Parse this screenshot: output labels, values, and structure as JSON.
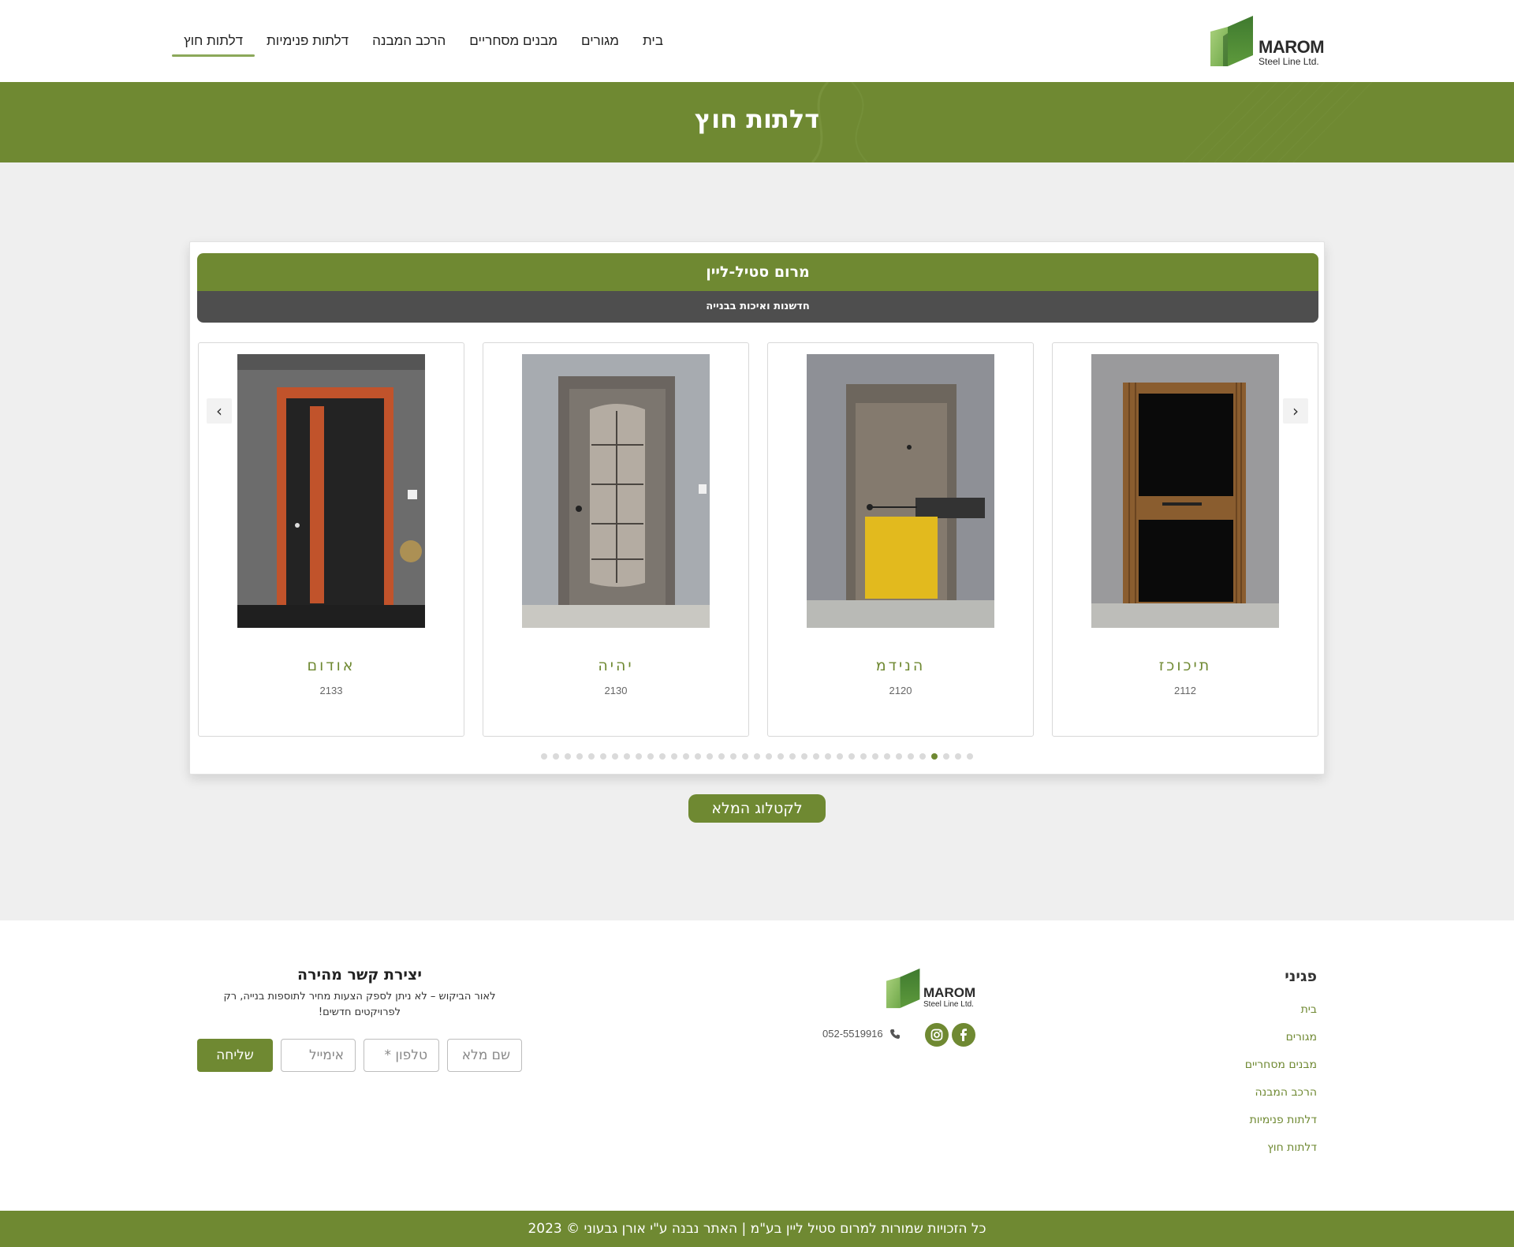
{
  "header": {
    "logo": {
      "brand": "MAROM",
      "sub": "Steel Line Ltd."
    },
    "nav": [
      {
        "label": "בית"
      },
      {
        "label": "מגורים"
      },
      {
        "label": "מבנים מסחריים"
      },
      {
        "label": "הרכב המבנה"
      },
      {
        "label": "דלתות פנימיות"
      },
      {
        "label": "דלתות חוץ",
        "active": true
      }
    ]
  },
  "banner": {
    "title": "דלתות חוץ"
  },
  "carousel": {
    "title": "מרום סטיל-ליין",
    "subtitle": "חדשנות ואיכות בבנייה",
    "prev_icon": "chevron-left-icon",
    "next_icon": "chevron-right-icon",
    "dot_count": 37,
    "active_dot": 33,
    "items": [
      {
        "name": "תיכוכז",
        "code": "2112"
      },
      {
        "name": "הנידמ",
        "code": "2120"
      },
      {
        "name": "יהיה",
        "code": "2130"
      },
      {
        "name": "אודום",
        "code": "2133"
      }
    ],
    "catalog_button": "לקטלוג המלא"
  },
  "footer": {
    "pages_title": "פגיני",
    "pages": [
      "בית",
      "מגורים",
      "מבנים מסחריים",
      "הרכב המבנה",
      "דלתות פנימיות",
      "דלתות חוץ"
    ],
    "logo": {
      "brand": "MAROM",
      "sub": "Steel Line Ltd."
    },
    "phone": "052-5519916",
    "social": [
      "facebook-icon",
      "instagram-icon"
    ],
    "contact": {
      "title": "יצירת קשר מהירה",
      "description": "לאור הביקוש – לא ניתן לספק הצעות מחיר לתוספות בנייה, רק לפרויקטים חדשים!",
      "fields": {
        "name_placeholder": "שם מלא",
        "phone_placeholder": "טלפון *",
        "email_placeholder": "אימייל"
      },
      "send_label": "שליחה"
    },
    "copyright": "2023 © כל הזכויות שמורות למרום סטיל ליין בע\"מ | האתר נבנה ע\"י אורן גבעוני"
  },
  "colors": {
    "brand_green": "#6f8932",
    "dark_bar": "#4e4e4e",
    "light_green": "#8ba85a"
  }
}
